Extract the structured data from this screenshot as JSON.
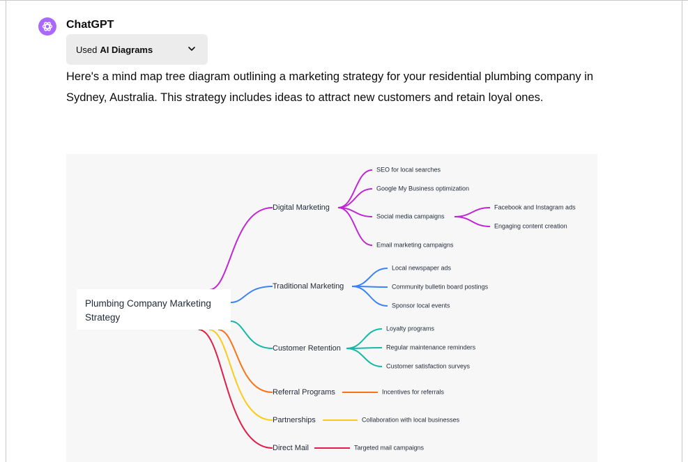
{
  "chat": {
    "sender": "ChatGPT",
    "tool_prefix": "Used",
    "tool_name": "AI Diagrams",
    "message": "Here's a mind map tree diagram outlining a marketing strategy for your residential plumbing company in Sydney, Australia. This strategy includes ideas to attract new customers and retain loyal ones."
  },
  "icons": {
    "avatar": "openai-logo-icon",
    "tool_toggle": "chevron-down-icon"
  },
  "colors": {
    "avatar_bg": "#ab68ff",
    "digital": "#c026d3",
    "traditional": "#3b82f6",
    "retention": "#14b8a6",
    "referral": "#f97316",
    "partnerships": "#facc15",
    "direct_mail": "#e11d48"
  },
  "mindmap": {
    "root": "Plumbing Company Marketing Strategy",
    "branches": [
      {
        "label": "Digital Marketing",
        "children": [
          {
            "label": "SEO for local searches"
          },
          {
            "label": "Google My Business optimization"
          },
          {
            "label": "Social media campaigns",
            "children": [
              "Facebook and Instagram ads",
              "Engaging content creation"
            ]
          },
          {
            "label": "Email marketing campaigns"
          }
        ]
      },
      {
        "label": "Traditional Marketing",
        "children": [
          {
            "label": "Local newspaper ads"
          },
          {
            "label": "Community bulletin board postings"
          },
          {
            "label": "Sponsor local events"
          }
        ]
      },
      {
        "label": "Customer Retention",
        "children": [
          {
            "label": "Loyalty programs"
          },
          {
            "label": "Regular maintenance reminders"
          },
          {
            "label": "Customer satisfaction surveys"
          }
        ]
      },
      {
        "label": "Referral Programs",
        "children": [
          {
            "label": "Incentives for referrals"
          }
        ]
      },
      {
        "label": "Partnerships",
        "children": [
          {
            "label": "Collaboration with local businesses"
          }
        ]
      },
      {
        "label": "Direct Mail",
        "children": [
          {
            "label": "Targeted mail campaigns"
          }
        ]
      }
    ]
  }
}
